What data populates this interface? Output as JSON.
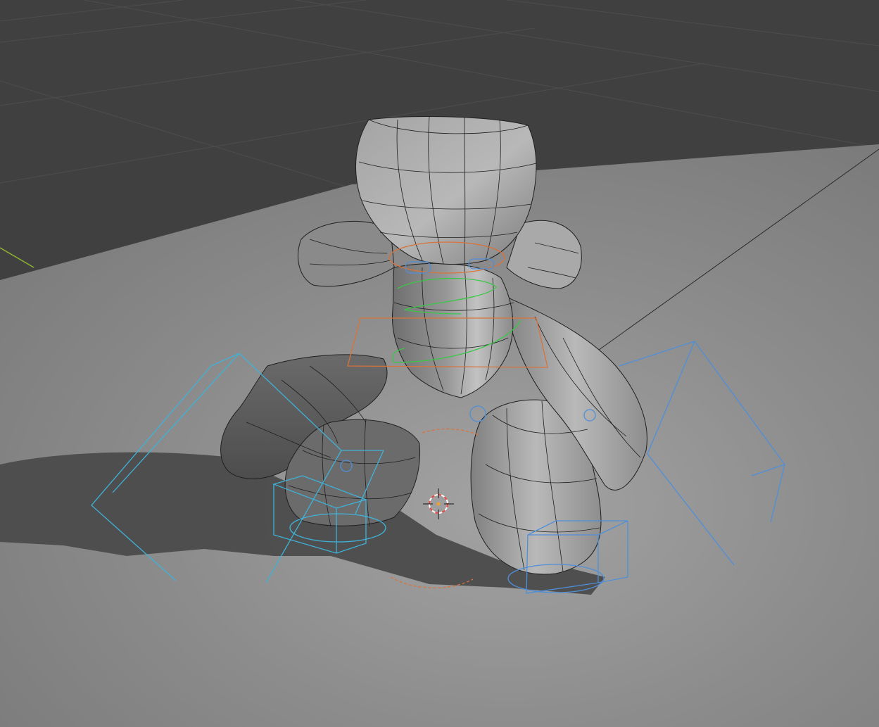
{
  "viewport": {
    "view": "3d-perspective",
    "shading": "rendered",
    "overlays": [
      "wireframe",
      "rig-controls",
      "3d-cursor",
      "world-grid"
    ]
  },
  "colors": {
    "background": "#404040",
    "grid_line": "#4e4e4e",
    "floor_light": "#9a9a9a",
    "floor_mid": "#858585",
    "floor_dark": "#767676",
    "shadow": "#4a4a4a",
    "mesh_light": "#b7b7b7",
    "mesh_mid": "#8c8c8c",
    "mesh_dark": "#5f5f5f",
    "wire": "#1c1c1c",
    "ctrl_blue": "#4f8fd8",
    "ctrl_cyan": "#3fb2d9",
    "ctrl_green": "#39c847",
    "ctrl_orange": "#d9733a",
    "cursor_red": "#e8463e",
    "cursor_white": "#ffffff",
    "x_axis": "#8fb32f"
  },
  "rig_controls": [
    {
      "name": "head-ring",
      "color_key": "ctrl_orange"
    },
    {
      "name": "eye-left",
      "color_key": "ctrl_blue"
    },
    {
      "name": "eye-right",
      "color_key": "ctrl_blue"
    },
    {
      "name": "neck-spiral",
      "color_key": "ctrl_green"
    },
    {
      "name": "torso-plane",
      "color_key": "ctrl_orange"
    },
    {
      "name": "hand-left-cage",
      "color_key": "ctrl_cyan"
    },
    {
      "name": "hand-right-cage",
      "color_key": "ctrl_blue"
    },
    {
      "name": "foot-left-box",
      "color_key": "ctrl_cyan"
    },
    {
      "name": "foot-right-box",
      "color_key": "ctrl_blue"
    },
    {
      "name": "root-ring",
      "color_key": "ctrl_orange"
    }
  ],
  "icons": {
    "cursor": "3d-cursor-icon",
    "pivot": "pivot-gizmo-icon"
  }
}
